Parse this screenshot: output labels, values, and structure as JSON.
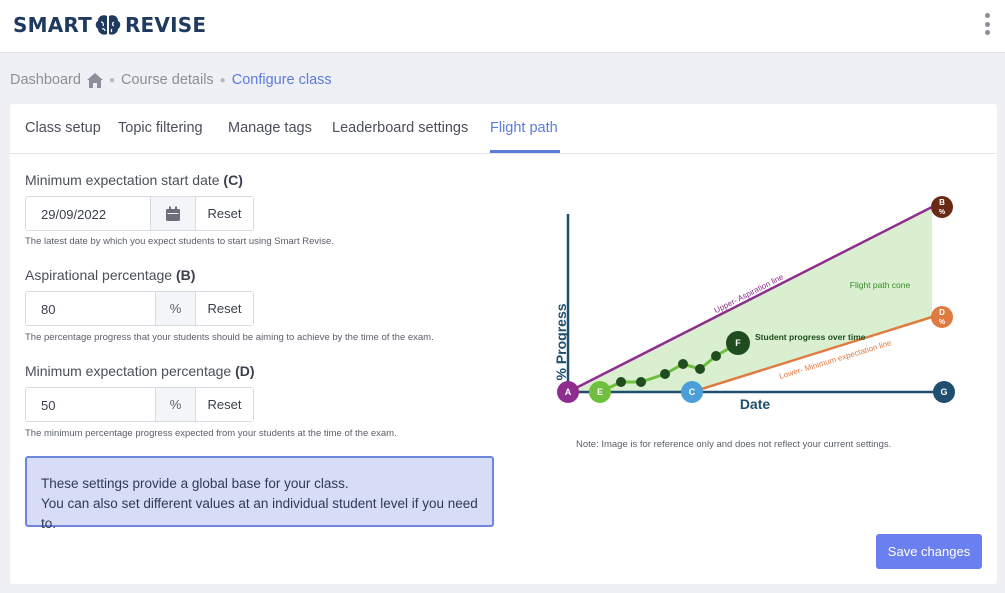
{
  "header": {
    "logo_left": "SMART",
    "logo_right": "REVISE"
  },
  "breadcrumb": {
    "dashboard": "Dashboard",
    "course": "Course details",
    "current": "Configure class"
  },
  "tabs": [
    {
      "label": "Class setup"
    },
    {
      "label": "Topic filtering"
    },
    {
      "label": "Manage tags"
    },
    {
      "label": "Leaderboard settings"
    },
    {
      "label": "Flight path"
    }
  ],
  "active_tab": "Flight path",
  "form": {
    "start_date": {
      "label": "Minimum expectation start date",
      "key": "(C)",
      "value": "29/09/2022",
      "reset": "Reset",
      "help": "The latest date by which you expect students to start using Smart Revise."
    },
    "aspirational": {
      "label": "Aspirational percentage",
      "key": "(B)",
      "value": "80",
      "unit": "%",
      "reset": "Reset",
      "help": "The percentage progress that your students should be aiming to achieve by the time of the exam."
    },
    "minimum": {
      "label": "Minimum expectation percentage",
      "key": "(D)",
      "value": "50",
      "unit": "%",
      "reset": "Reset",
      "help": "The minimum percentage progress expected from your students at the time of the exam."
    }
  },
  "info": {
    "line1": "These settings provide a global base for your class.",
    "line2": "You can also set different values at an individual student level if you need to."
  },
  "diagram": {
    "y_axis": "% Progress",
    "x_axis": "Date",
    "upper_line": "Upper- Aspiration line",
    "lower_line": "Lower- Minimum expectation line",
    "cone_label": "Flight path cone",
    "progress_label": "Student progress over time",
    "points": {
      "A": "A",
      "B": "B",
      "B_unit": "%",
      "C": "C",
      "D": "D",
      "D_unit": "%",
      "E": "E",
      "F": "F",
      "G": "G"
    },
    "colors": {
      "upper": "#8e2d8e",
      "lower": "#e07a3f",
      "axis": "#1f4e6e",
      "cone": "#d9efcf",
      "progress": "#6fbf3f",
      "progress_dot": "#1f4d1f"
    }
  },
  "note": "Note: Image is for reference only and does not reflect your current settings.",
  "save_button": "Save changes",
  "colors": {
    "accent": "#5c7cdc",
    "button": "#6a7ff0"
  }
}
